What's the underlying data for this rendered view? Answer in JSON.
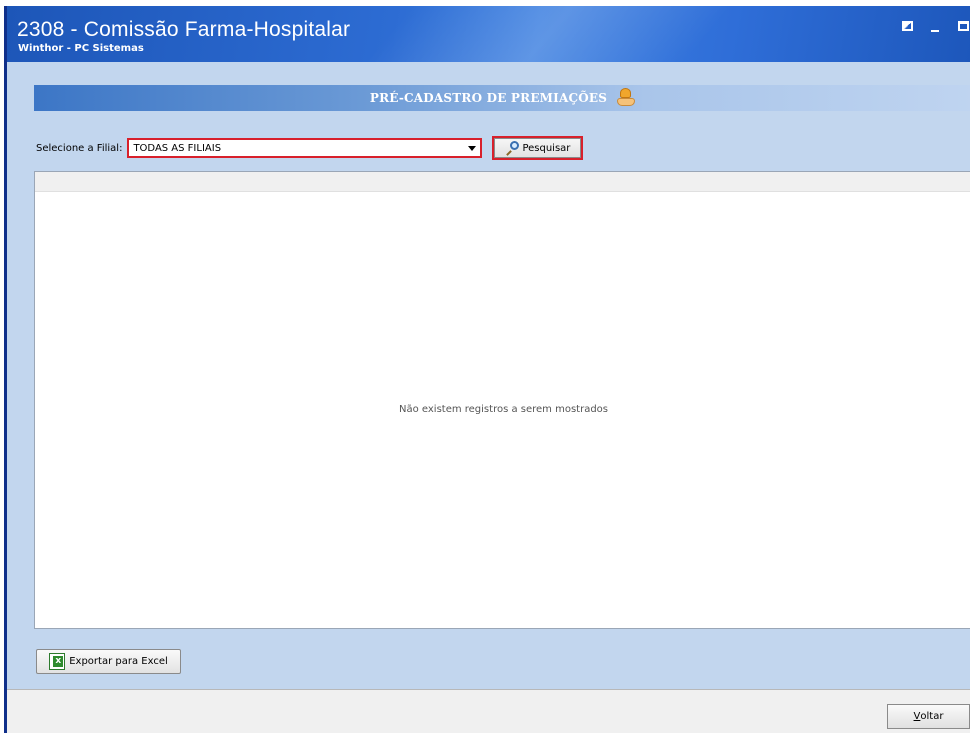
{
  "window": {
    "title": "2308 - Comissão Farma-Hospitalar",
    "subtitle": "Winthor - PC Sistemas"
  },
  "section": {
    "title": "PRÉ-CADASTRO DE PREMIAÇÕES",
    "icon": "award-hand-coin-icon"
  },
  "filter": {
    "label": "Selecione a Filial:",
    "selected": "TODAS AS FILIAIS",
    "search_label": "Pesquisar"
  },
  "grid": {
    "empty_message": "Não existem registros a serem mostrados"
  },
  "actions": {
    "export_label": "Exportar para Excel",
    "back_label_first": "V",
    "back_label_rest": "oltar"
  },
  "colors": {
    "accent_border": "#d8202b",
    "title_bar": "#2d6cd3",
    "background": "#c2d6ee"
  }
}
